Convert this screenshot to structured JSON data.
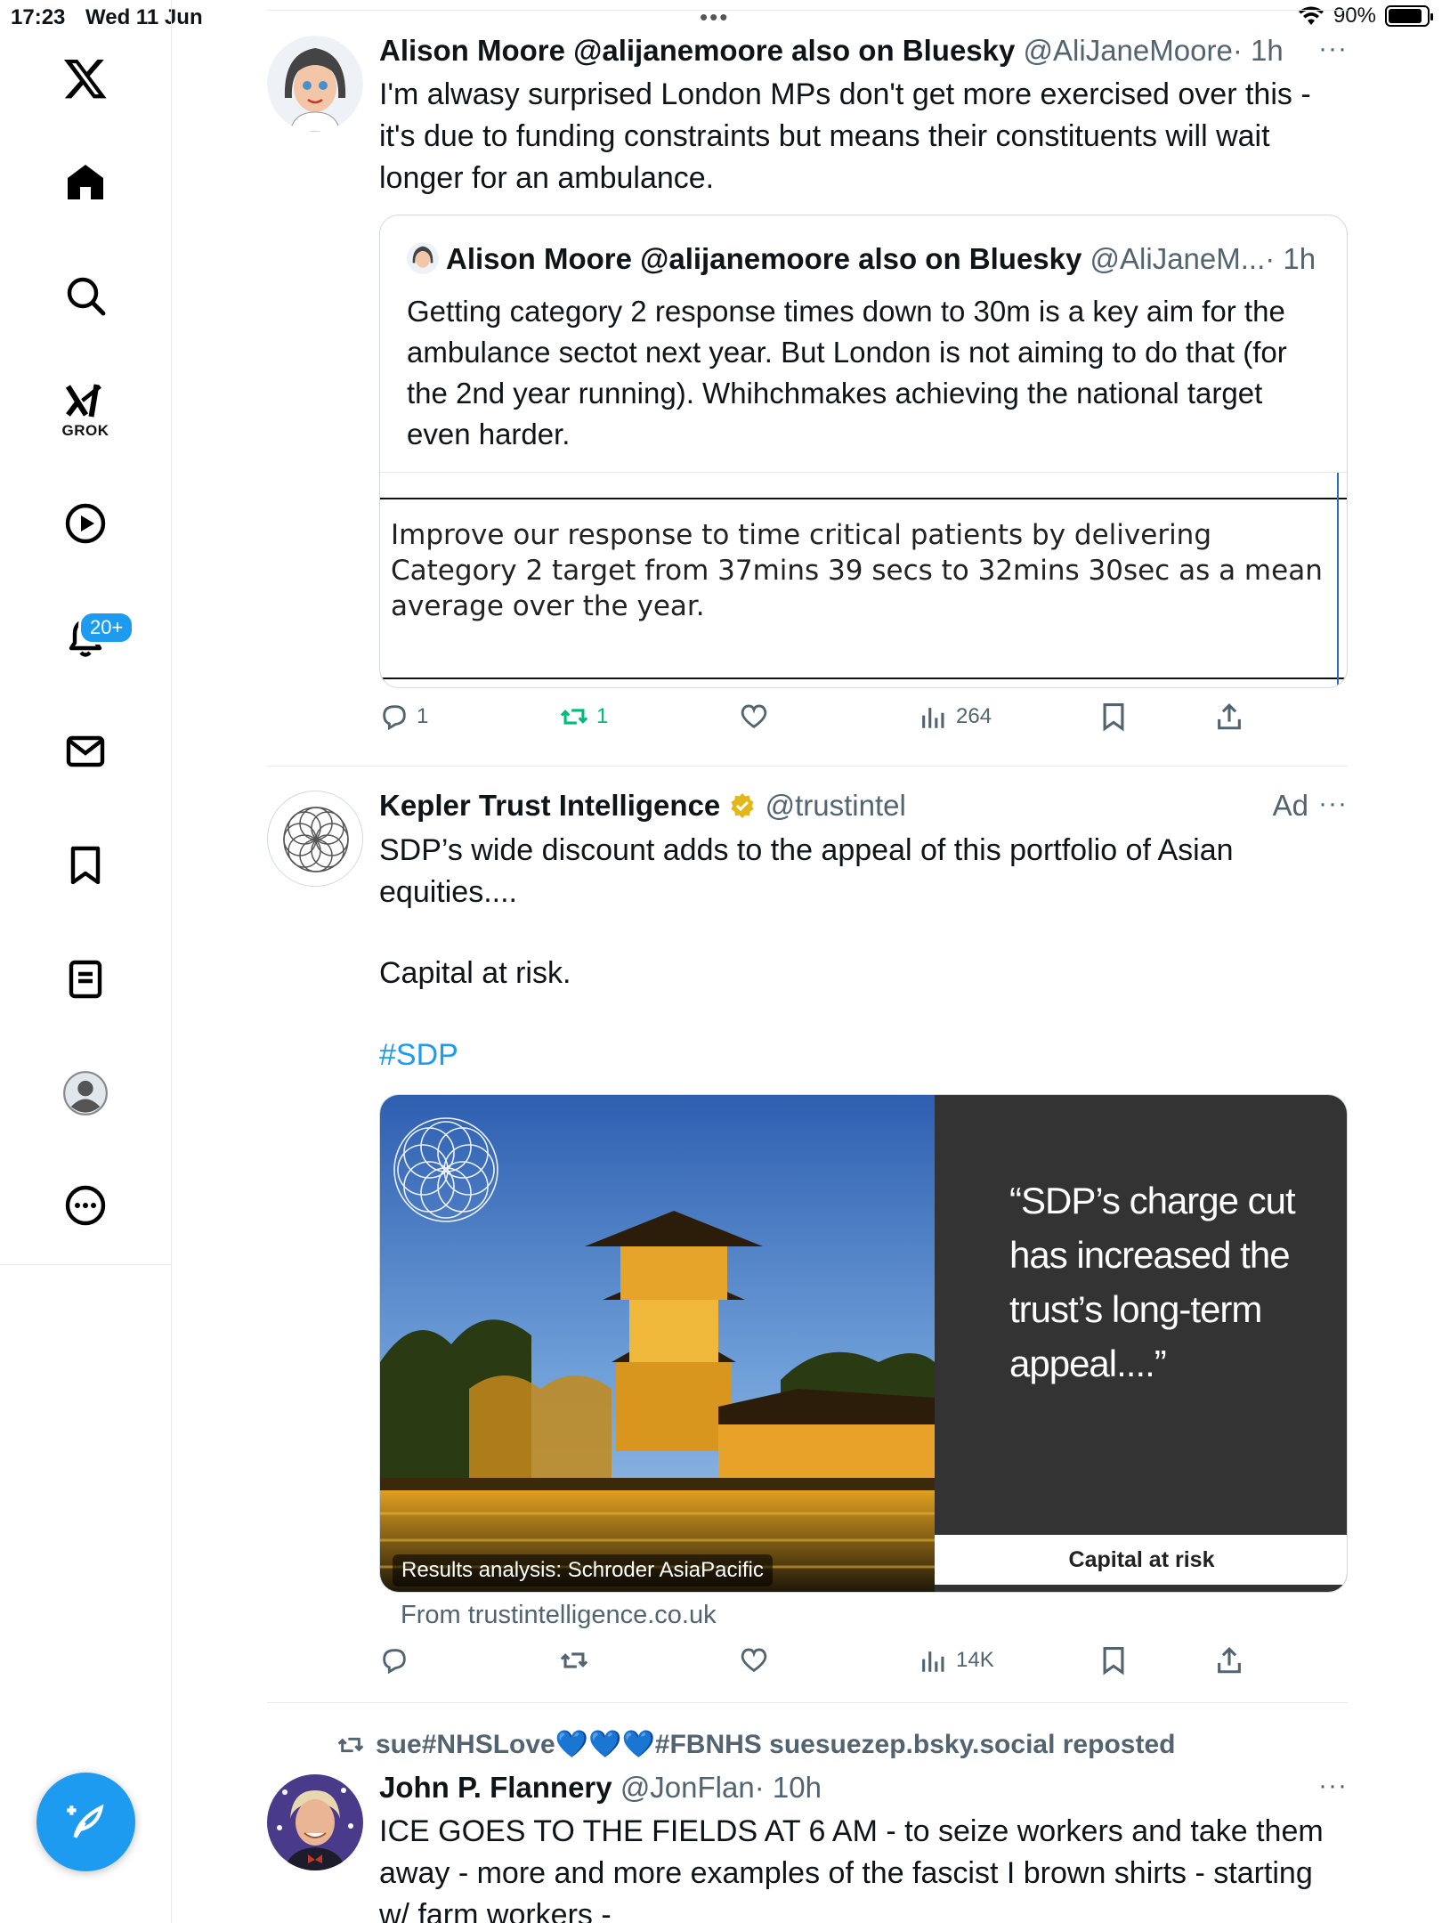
{
  "status_bar": {
    "time": "17:23",
    "date": "Wed 11 Jun",
    "battery": "90%",
    "battery_level": 0.9
  },
  "sidebar": {
    "items": [
      {
        "name": "home",
        "label": ""
      },
      {
        "name": "explore",
        "label": ""
      },
      {
        "name": "grok",
        "label": "GROK"
      },
      {
        "name": "videos",
        "label": ""
      },
      {
        "name": "notifications",
        "label": ""
      },
      {
        "name": "messages",
        "label": ""
      },
      {
        "name": "bookmarks",
        "label": ""
      },
      {
        "name": "lists",
        "label": ""
      },
      {
        "name": "profile",
        "label": ""
      },
      {
        "name": "more",
        "label": ""
      }
    ],
    "notifications_badge": "20+"
  },
  "posts": [
    {
      "author": "Alison Moore @alijanemoore also on Bluesky",
      "handle": "@AliJaneMoore",
      "time": "· 1h",
      "text": "I'm alwasy surprised London MPs don't get more exercised over this - it's due to funding constraints but means their constituents will wait longer for an ambulance.",
      "quote": {
        "author": "Alison Moore @alijanemoore also on Bluesky",
        "handle": "@AliJaneM...",
        "time": "· 1h",
        "text": "Getting category 2 response times down to 30m is a key aim for the ambulance sectot next year. But London is not aiming to do that (for the 2nd year running). Whihchmakes achieving the national target even harder.",
        "image_text": "Improve our response to time critical patients by delivering Category 2 target from 37mins 39 secs to 32mins 30sec as a mean average over the year."
      },
      "actions": {
        "replies": "1",
        "reposts": "1",
        "likes": "",
        "views": "264"
      }
    },
    {
      "author": "Kepler Trust Intelligence",
      "handle": "@trustintel",
      "ad_label": "Ad",
      "text_lines": [
        "SDP’s wide discount adds to the appeal of this portfolio of Asian equities....",
        "Capital at risk."
      ],
      "hashtag": "#SDP",
      "card": {
        "quote": "“SDP’s charge cut has increased the trust’s long-term appeal....”",
        "caption": "Capital at risk",
        "overlay": "Results analysis: Schroder AsiaPacific",
        "source": "From trustintelligence.co.uk"
      },
      "actions": {
        "replies": "",
        "reposts": "",
        "likes": "",
        "views": "14K"
      }
    },
    {
      "repost_by": "sue#NHSLove💙💙💙#FBNHS suesuezep.bsky.social reposted",
      "author": "John P. Flannery",
      "handle": "@JonFlan",
      "time": "· 10h",
      "text": "ICE GOES TO THE FIELDS AT 6 AM - to seize workers and take them away - more and more examples of the fascist I brown shirts - starting w/ farm workers -"
    }
  ],
  "colors": {
    "accent": "#1d9bf0",
    "repost_green": "#00ba7c",
    "secondary_text": "#536471",
    "verified_gold": "#e2b719"
  }
}
